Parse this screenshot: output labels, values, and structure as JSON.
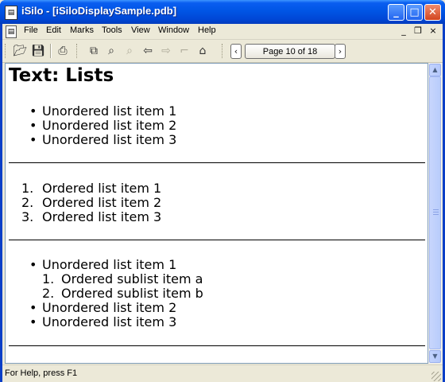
{
  "window": {
    "title": "iSilo - [iSiloDisplaySample.pdb]",
    "app_icon": "isilo-doc-icon",
    "controls": {
      "minimize": "_",
      "maximize": "□",
      "close": "✕"
    }
  },
  "menubar": {
    "items": [
      {
        "label": "File"
      },
      {
        "label": "Edit"
      },
      {
        "label": "Marks"
      },
      {
        "label": "Tools"
      },
      {
        "label": "View"
      },
      {
        "label": "Window"
      },
      {
        "label": "Help"
      }
    ],
    "mdi_controls": {
      "minimize": "_",
      "restore": "❐",
      "close": "×"
    }
  },
  "toolbar": {
    "page_indicator": "Page 10 of 18",
    "prev_label": "‹",
    "next_label": "›",
    "tools": [
      "open-folder-icon",
      "save-icon",
      "print-icon",
      "copy-icon",
      "find-icon",
      "find-next-icon",
      "back-icon",
      "forward-icon",
      "bookmark-icon",
      "home-icon"
    ]
  },
  "document": {
    "heading": "Text: Lists",
    "unordered_list": [
      "Unordered list item 1",
      "Unordered list item 2",
      "Unordered list item 3"
    ],
    "ordered_list": [
      {
        "number": "1.",
        "text": "Ordered list item 1"
      },
      {
        "number": "2.",
        "text": "Ordered list item 2"
      },
      {
        "number": "3.",
        "text": "Ordered list item 3"
      }
    ],
    "nested_list": {
      "first": "Unordered list item 1",
      "sublist": [
        {
          "number": "1.",
          "text": "Ordered sublist item a"
        },
        {
          "number": "2.",
          "text": "Ordered sublist item b"
        }
      ],
      "rest": [
        "Unordered list item 2",
        "Unordered list item 3"
      ]
    }
  },
  "statusbar": {
    "text": "For Help, press F1"
  }
}
